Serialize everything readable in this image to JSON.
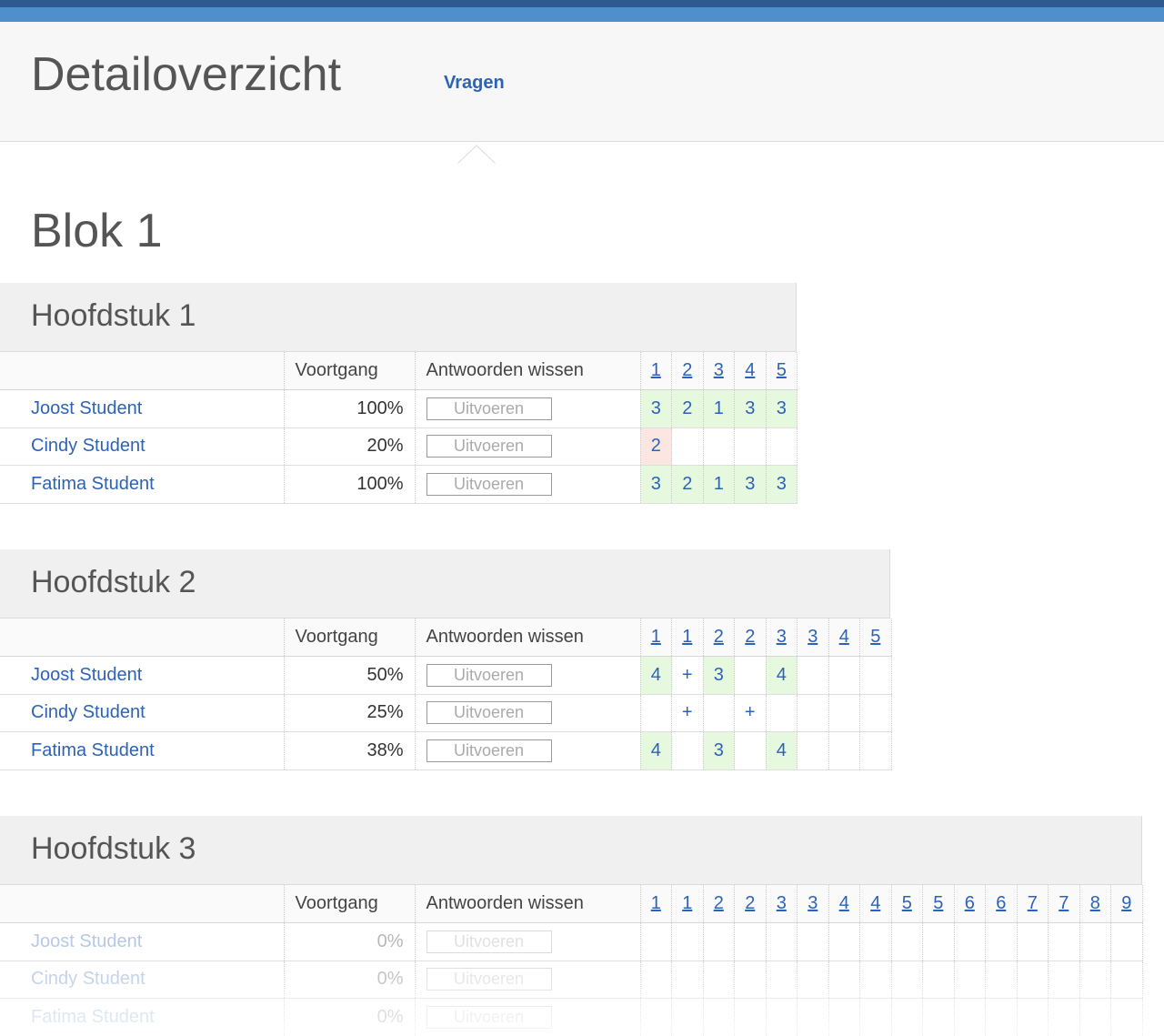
{
  "header": {
    "title": "Detailoverzicht",
    "nav_tab": "Vragen"
  },
  "block": {
    "title": "Blok 1"
  },
  "columns": {
    "progress": "Voortgang",
    "reset": "Antwoorden wissen"
  },
  "button_label": "Uitvoeren",
  "chapters": [
    {
      "title": "Hoofdstuk 1",
      "questions": [
        "1",
        "2",
        "3",
        "4",
        "5"
      ],
      "rows": [
        {
          "student": "Joost Student",
          "progress": "100%",
          "cells": [
            "3",
            "2",
            "1",
            "3",
            "3"
          ]
        },
        {
          "student": "Cindy Student",
          "progress": "20%",
          "cells": [
            "2",
            "",
            "",
            "",
            ""
          ]
        },
        {
          "student": "Fatima Student",
          "progress": "100%",
          "cells": [
            "3",
            "2",
            "1",
            "3",
            "3"
          ]
        }
      ]
    },
    {
      "title": "Hoofdstuk 2",
      "questions": [
        "1",
        "1",
        "2",
        "2",
        "3",
        "3",
        "4",
        "5"
      ],
      "rows": [
        {
          "student": "Joost Student",
          "progress": "50%",
          "cells": [
            "4",
            "+",
            "3",
            "",
            "4",
            "",
            "",
            ""
          ]
        },
        {
          "student": "Cindy Student",
          "progress": "25%",
          "cells": [
            "",
            "+",
            "",
            "+",
            "",
            "",
            "",
            ""
          ]
        },
        {
          "student": "Fatima Student",
          "progress": "38%",
          "cells": [
            "4",
            "",
            "3",
            "",
            "4",
            "",
            "",
            ""
          ]
        }
      ]
    },
    {
      "title": "Hoofdstuk 3",
      "questions": [
        "1",
        "1",
        "2",
        "2",
        "3",
        "3",
        "4",
        "4",
        "5",
        "5",
        "6",
        "6",
        "7",
        "7",
        "8",
        "9"
      ],
      "rows": [
        {
          "student": "Joost Student",
          "progress": "0%"
        },
        {
          "student": "Cindy Student",
          "progress": "0%"
        },
        {
          "student": "Fatima Student",
          "progress": "0%"
        }
      ]
    }
  ],
  "colors": {
    "link": "#2d63b7",
    "correct_bg": "#e6f8de",
    "wrong_bg": "#fbe6e1",
    "topbar": "#4f8fcb"
  }
}
